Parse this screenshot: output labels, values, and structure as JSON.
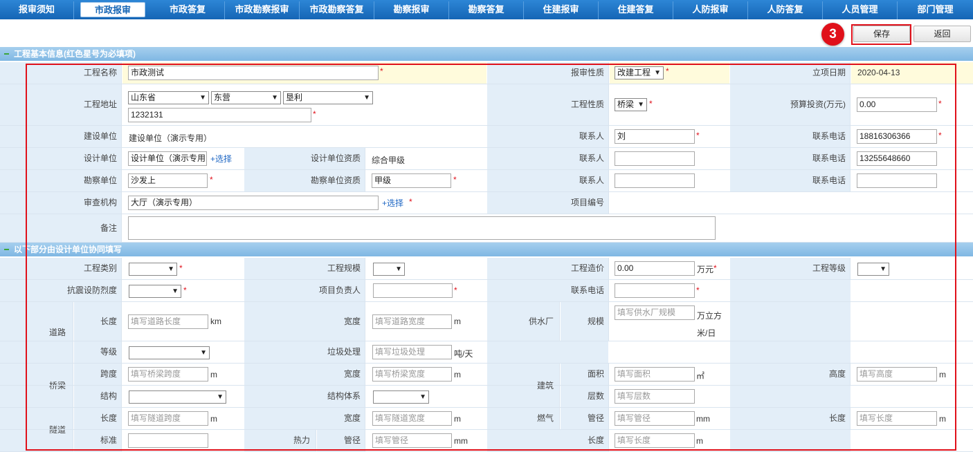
{
  "nav": {
    "tabs": [
      "报审须知",
      "市政报审",
      "市政答复",
      "市政勘察报审",
      "市政勘察答复",
      "勘察报审",
      "勘察答复",
      "住建报审",
      "住建答复",
      "人防报审",
      "人防答复",
      "人员管理",
      "部门管理"
    ],
    "active_index": 1
  },
  "toolbar": {
    "save_label": "保存",
    "back_label": "返回",
    "step_badge": "3"
  },
  "section1": {
    "title": "工程基本信息(红色星号为必填项)"
  },
  "section2": {
    "title": "以下部分由设计单位协同填写"
  },
  "labels": {
    "project_name": "工程名称",
    "review_type": "报审性质",
    "approval_date": "立项日期",
    "project_address": "工程地址",
    "project_nature": "工程性质",
    "budget": "预算投资(万元)",
    "builder": "建设单位",
    "contact": "联系人",
    "phone": "联系电话",
    "designer": "设计单位",
    "designer_qual": "设计单位资质",
    "surveyor": "勘察单位",
    "surveyor_qual": "勘察单位资质",
    "review_org": "审查机构",
    "project_no": "项目编号",
    "remark": "备注",
    "category": "工程类别",
    "scale": "工程规模",
    "cost": "工程造价",
    "grade": "工程等级",
    "seismic": "抗震设防烈度",
    "leader": "项目负责人",
    "road": "道路",
    "length": "长度",
    "width": "宽度",
    "level": "等级",
    "garbage": "垃圾处理",
    "water_plant": "供水厂",
    "scale2": "规模",
    "bridge": "桥梁",
    "span": "跨度",
    "structure": "结构",
    "struct_system": "结构体系",
    "building": "建筑",
    "area": "面积",
    "height": "高度",
    "floors": "层数",
    "tunnel": "隧道",
    "gas": "燃气",
    "pipe_dia": "管径",
    "standard": "标准",
    "heat": "热力"
  },
  "values": {
    "project_name": "市政测试",
    "review_type": "改建工程",
    "approval_date": "2020-04-13",
    "province": "山东省",
    "city": "东营",
    "county": "垦利",
    "address_detail": "1232131",
    "project_nature": "桥梁",
    "budget": "0.00",
    "builder": "建设单位（演示专用）",
    "contact1": "刘",
    "phone1": "18816306366",
    "designer": "设计单位（演示专用",
    "designer_qual": "综合甲级",
    "phone2": "13255648660",
    "surveyor": "沙发上",
    "surveyor_qual": "甲级",
    "review_org": "大厅（演示专用）",
    "cost": "0.00",
    "select_link": "选择"
  },
  "units": {
    "km": "km",
    "m": "m",
    "wan_yuan": "万元",
    "water_scale": "万立方米/日",
    "per_day": "吨/天",
    "m2": "㎡",
    "mm": "mm"
  },
  "placeholders": {
    "road_length": "填写道路长度",
    "road_width": "填写道路宽度",
    "water_scale": "填写供水厂规模",
    "garbage": "填写垃圾处理",
    "bridge_span": "填写桥梁跨度",
    "bridge_width": "填写桥梁宽度",
    "area": "填写面积",
    "height": "填写高度",
    "floors": "填写层数",
    "tunnel_span": "填写隧道跨度",
    "tunnel_width": "填写隧道宽度",
    "pipe": "填写管径",
    "length": "填写长度"
  }
}
